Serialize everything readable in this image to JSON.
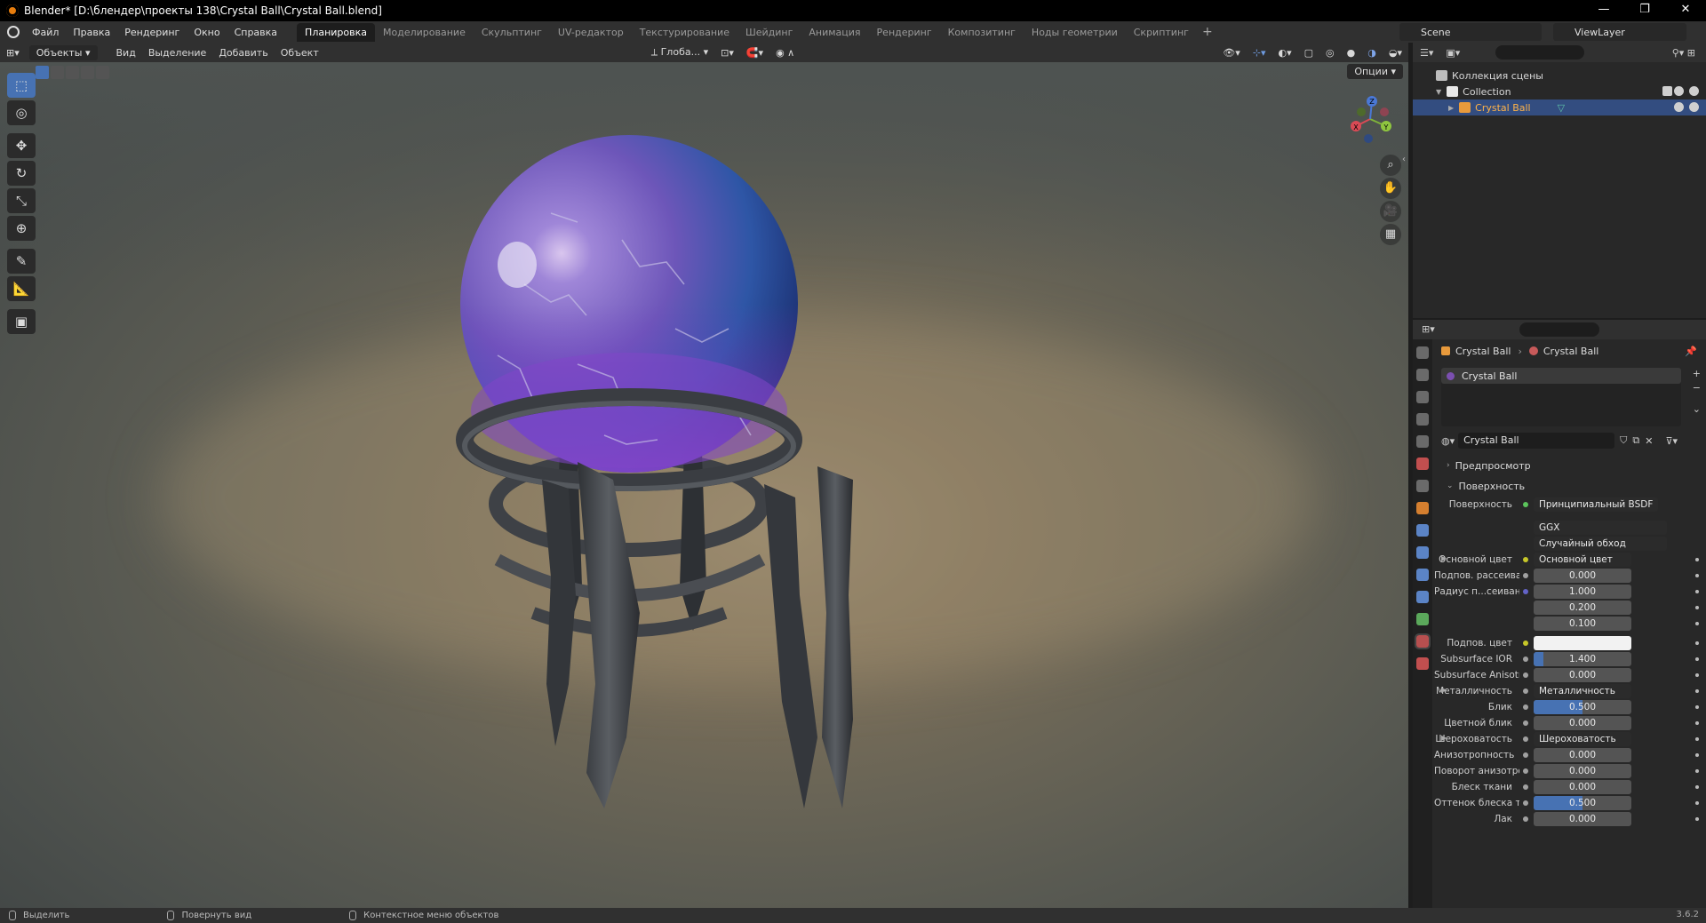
{
  "window": {
    "title": "Blender* [D:\\блендер\\проекты 138\\Crystal Ball\\Crystal Ball.blend]",
    "minimize": "—",
    "maximize": "❐",
    "close": "✕"
  },
  "menubar": {
    "menus": [
      "Файл",
      "Правка",
      "Рендеринг",
      "Окно",
      "Справка"
    ],
    "workspaces": [
      "Планировка",
      "Моделирование",
      "Скульптинг",
      "UV-редактор",
      "Текстурирование",
      "Шейдинг",
      "Анимация",
      "Рендеринг",
      "Композитинг",
      "Ноды геометрии",
      "Скриптинг"
    ],
    "active_workspace": "Планировка",
    "add_tab": "+",
    "scene": "Scene",
    "view_layer": "ViewLayer"
  },
  "viewport_header": {
    "mode": "Объекты",
    "menus": [
      "Вид",
      "Выделение",
      "Добавить",
      "Объект"
    ],
    "transform_orientation": "Глоба...",
    "options": "Опции"
  },
  "gizmo_axes": {
    "x": "X",
    "y": "Y",
    "z": "Z"
  },
  "tools": [
    {
      "name": "select-box-tool",
      "glyph": "⬚",
      "active": true
    },
    {
      "name": "cursor-tool",
      "glyph": "◎"
    },
    {
      "name": "move-tool",
      "glyph": "✥"
    },
    {
      "name": "rotate-tool",
      "glyph": "↻"
    },
    {
      "name": "scale-tool",
      "glyph": "⤡"
    },
    {
      "name": "transform-tool",
      "glyph": "⊕"
    },
    {
      "name": "annotate-tool",
      "glyph": "✎"
    },
    {
      "name": "measure-tool",
      "glyph": "📐"
    },
    {
      "name": "add-cube-tool",
      "glyph": "▣"
    }
  ],
  "nav_buttons": [
    {
      "name": "zoom-icon",
      "glyph": "⌕"
    },
    {
      "name": "hand-pan-icon",
      "glyph": "✋"
    },
    {
      "name": "camera-view-icon",
      "glyph": "🎥"
    },
    {
      "name": "ortho-grid-icon",
      "glyph": "▦"
    }
  ],
  "outliner": {
    "scene_collection": "Коллекция сцены",
    "collection": "Collection",
    "object": "Crystal Ball"
  },
  "properties": {
    "breadcrumb_object": "Crystal Ball",
    "breadcrumb_material": "Crystal Ball",
    "slot": "Crystal Ball",
    "material_name": "Crystal Ball",
    "preview_panel": "Предпросмотр",
    "surface_panel": "Поверхность",
    "surface_label": "Поверхность",
    "surface_value": "Принципиальный BSDF",
    "distribution": "GGX",
    "subsurface_method": "Случайный обход",
    "rows": [
      {
        "label": "Основной цвет",
        "value": "Основной цвет",
        "socket": "#c7c729",
        "kind": "link",
        "expand": true
      },
      {
        "label": "Подпов. рассеива...",
        "value": "0.000",
        "socket": "#a1a1a1",
        "kind": "num",
        "fill": 0
      },
      {
        "label": "Радиус п...сеивания",
        "value": "1.000",
        "socket": "#6363c7",
        "kind": "num",
        "fill": 0
      },
      {
        "label": "",
        "value": "0.200",
        "socket": "",
        "kind": "num",
        "fill": 0
      },
      {
        "label": "",
        "value": "0.100",
        "socket": "",
        "kind": "num",
        "fill": 0
      },
      {
        "label": "Подпов. цвет",
        "value": "",
        "socket": "#c7c729",
        "kind": "color",
        "color": "#f2f2f2"
      },
      {
        "label": "Subsurface IOR",
        "value": "1.400",
        "socket": "#a1a1a1",
        "kind": "num",
        "fill": 0.1
      },
      {
        "label": "Subsurface Anisotr...",
        "value": "0.000",
        "socket": "#a1a1a1",
        "kind": "num",
        "fill": 0
      },
      {
        "label": "Металличность",
        "value": "Металличность",
        "socket": "#a1a1a1",
        "kind": "link",
        "expand": true
      },
      {
        "label": "Блик",
        "value": "0.500",
        "socket": "#a1a1a1",
        "kind": "num",
        "fill": 0.5
      },
      {
        "label": "Цветной блик",
        "value": "0.000",
        "socket": "#a1a1a1",
        "kind": "num",
        "fill": 0
      },
      {
        "label": "Шероховатость",
        "value": "Шероховатость",
        "socket": "#a1a1a1",
        "kind": "link",
        "expand": true
      },
      {
        "label": "Анизотропность",
        "value": "0.000",
        "socket": "#a1a1a1",
        "kind": "num",
        "fill": 0
      },
      {
        "label": "Поворот анизотро...",
        "value": "0.000",
        "socket": "#a1a1a1",
        "kind": "num",
        "fill": 0
      },
      {
        "label": "Блеск ткани",
        "value": "0.000",
        "socket": "#a1a1a1",
        "kind": "num",
        "fill": 0
      },
      {
        "label": "Оттенок блеска тк...",
        "value": "0.500",
        "socket": "#a1a1a1",
        "kind": "num",
        "fill": 0.5
      },
      {
        "label": "Лак",
        "value": "0.000",
        "socket": "#a1a1a1",
        "kind": "num",
        "fill": 0
      }
    ]
  },
  "statusbar": {
    "select": "Выделить",
    "rotate_view": "Повернуть вид",
    "context_menu": "Контекстное меню объектов",
    "version": "3.6.2"
  },
  "colors": {
    "accent": "#4772b3",
    "selection": "#334d80",
    "crystal_top": "#8a66c9",
    "crystal_bottom": "#2c55a8"
  }
}
